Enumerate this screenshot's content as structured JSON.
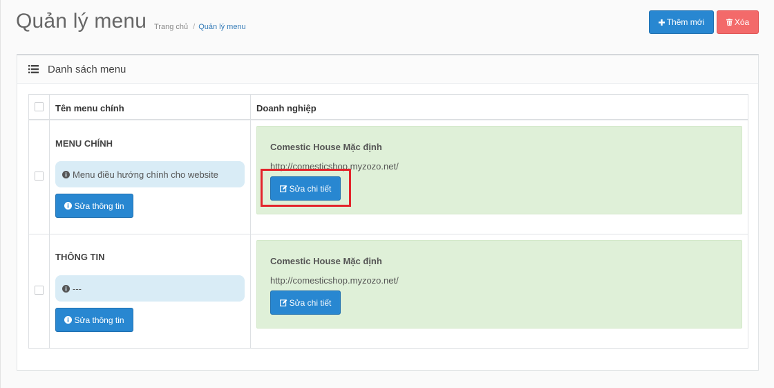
{
  "header": {
    "title": "Quản lý menu",
    "breadcrumb": {
      "home": "Trang chủ",
      "separator": "/",
      "current": "Quản lý menu"
    },
    "add_button": "Thêm mới",
    "delete_button": "Xóa"
  },
  "portlet": {
    "caption": "Danh sách menu",
    "columns": {
      "name": "Tên menu chính",
      "business": "Doanh nghiệp"
    },
    "rows": [
      {
        "name": "MENU CHÍNH",
        "description": "Menu điều hướng chính cho website",
        "edit_info_button": "Sửa thông tin",
        "business": {
          "name": "Comestic House Mặc định",
          "url": "http://comesticshop.myzozo.net/",
          "edit_detail_button": "Sửa chi tiết"
        }
      },
      {
        "name": "THÔNG TIN",
        "description": "---",
        "edit_info_button": "Sửa thông tin",
        "business": {
          "name": "Comestic House Mặc định",
          "url": "http://comesticshop.myzozo.net/",
          "edit_detail_button": "Sửa chi tiết"
        }
      }
    ]
  },
  "colors": {
    "primary": "#2887d1",
    "danger": "#f36a6a",
    "info_bg": "#d9ecf6",
    "success_bg": "#dff0d8",
    "highlight": "#e3242b"
  },
  "icons": {
    "add": "plus-icon",
    "delete": "trash-icon",
    "list": "list-icon",
    "info": "info-circle-icon",
    "edit": "edit-icon"
  }
}
